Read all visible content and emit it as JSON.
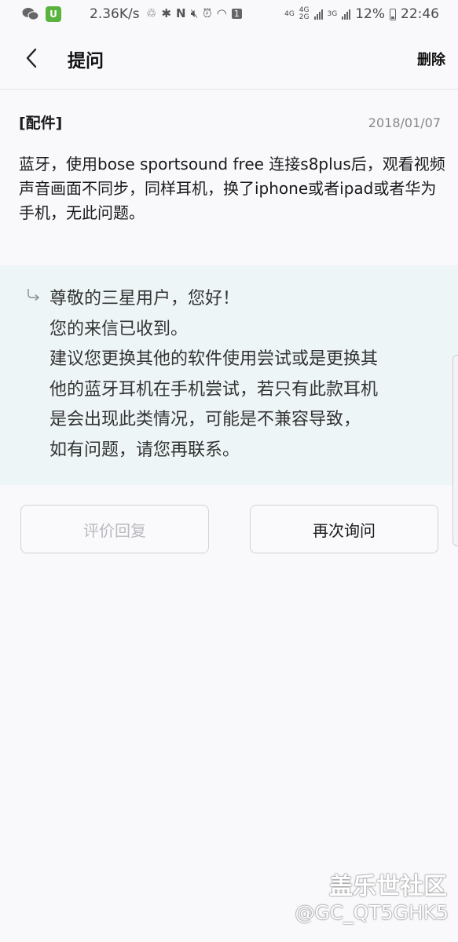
{
  "status_bar": {
    "speed": "2.36K/s",
    "net1": "4G",
    "net2a": "4G",
    "net2b": "2G",
    "net3": "3G",
    "battery": "12%",
    "time": "22:46",
    "sim_badge": "1"
  },
  "header": {
    "title": "提问",
    "delete_label": "删除"
  },
  "question": {
    "category": "[配件]",
    "date": "2018/01/07",
    "text": "蓝牙，使用bose sportsound free 连接s8plus后，观看视频声音画面不同步，同样耳机，换了iphone或者ipad或者华为手机，无此问题。"
  },
  "reply": {
    "lines": [
      "尊敬的三星用户，您好！",
      "您的来信已收到。",
      "建议您更换其他的软件使用尝试或是更换其",
      "他的蓝牙耳机在手机尝试，若只有此款耳机",
      "是会出现此类情况，可能是不兼容导致，",
      "如有问题，请您再联系。"
    ]
  },
  "buttons": {
    "rate_label": "评价回复",
    "ask_again_label": "再次询问"
  },
  "watermark": {
    "line1": "盖乐世社区",
    "line2": "@GC_QT5GHK5"
  },
  "colors": {
    "reply_background": "#eef5f7",
    "app_background": "#f9f8fb",
    "disabled_text": "#b9b9be"
  },
  "icons": [
    "wechat-icon",
    "app-icon",
    "back-arrow-icon",
    "reply-arrow-icon",
    "bluetooth-icon",
    "nfc-icon",
    "mute-icon",
    "alarm-icon",
    "wifi-icon",
    "signal-icon",
    "battery-icon"
  ]
}
